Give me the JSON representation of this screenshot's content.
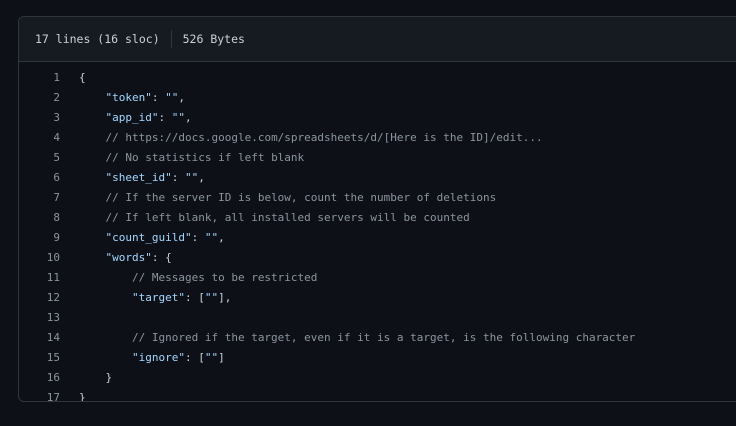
{
  "header": {
    "lines_info": "17 lines (16 sloc)",
    "size_info": "526 Bytes"
  },
  "colors": {
    "background": "#0d1117",
    "header_bg": "#161b22",
    "border": "#30363d",
    "text": "#c9d1d9",
    "key": "#a5d6ff",
    "comment": "#8b949e"
  },
  "code": {
    "lines": [
      {
        "num": "1",
        "indent": "",
        "parts": [
          {
            "t": "{",
            "k": "punct"
          }
        ]
      },
      {
        "num": "2",
        "indent": "    ",
        "parts": [
          {
            "t": "\"token\"",
            "k": "key"
          },
          {
            "t": ": ",
            "k": "punct"
          },
          {
            "t": "\"\"",
            "k": "str"
          },
          {
            "t": ",",
            "k": "punct"
          }
        ]
      },
      {
        "num": "3",
        "indent": "    ",
        "parts": [
          {
            "t": "\"app_id\"",
            "k": "key"
          },
          {
            "t": ": ",
            "k": "punct"
          },
          {
            "t": "\"\"",
            "k": "str"
          },
          {
            "t": ",",
            "k": "punct"
          }
        ]
      },
      {
        "num": "4",
        "indent": "    ",
        "parts": [
          {
            "t": "// https://docs.google.com/spreadsheets/d/[Here is the ID]/edit...",
            "k": "comment"
          }
        ]
      },
      {
        "num": "5",
        "indent": "    ",
        "parts": [
          {
            "t": "// No statistics if left blank",
            "k": "comment"
          }
        ]
      },
      {
        "num": "6",
        "indent": "    ",
        "parts": [
          {
            "t": "\"sheet_id\"",
            "k": "key"
          },
          {
            "t": ": ",
            "k": "punct"
          },
          {
            "t": "\"\"",
            "k": "str"
          },
          {
            "t": ",",
            "k": "punct"
          }
        ]
      },
      {
        "num": "7",
        "indent": "    ",
        "parts": [
          {
            "t": "// If the server ID is below, count the number of deletions",
            "k": "comment"
          }
        ]
      },
      {
        "num": "8",
        "indent": "    ",
        "parts": [
          {
            "t": "// If left blank, all installed servers will be counted",
            "k": "comment"
          }
        ]
      },
      {
        "num": "9",
        "indent": "    ",
        "parts": [
          {
            "t": "\"count_guild\"",
            "k": "key"
          },
          {
            "t": ": ",
            "k": "punct"
          },
          {
            "t": "\"\"",
            "k": "str"
          },
          {
            "t": ",",
            "k": "punct"
          }
        ]
      },
      {
        "num": "10",
        "indent": "    ",
        "parts": [
          {
            "t": "\"words\"",
            "k": "key"
          },
          {
            "t": ": {",
            "k": "punct"
          }
        ]
      },
      {
        "num": "11",
        "indent": "        ",
        "parts": [
          {
            "t": "// Messages to be restricted",
            "k": "comment"
          }
        ]
      },
      {
        "num": "12",
        "indent": "        ",
        "parts": [
          {
            "t": "\"target\"",
            "k": "key"
          },
          {
            "t": ": [",
            "k": "punct"
          },
          {
            "t": "\"\"",
            "k": "str"
          },
          {
            "t": "],",
            "k": "punct"
          }
        ]
      },
      {
        "num": "13",
        "indent": "",
        "parts": []
      },
      {
        "num": "14",
        "indent": "        ",
        "parts": [
          {
            "t": "// Ignored if the target, even if it is a target, is the following character",
            "k": "comment"
          }
        ]
      },
      {
        "num": "15",
        "indent": "        ",
        "parts": [
          {
            "t": "\"ignore\"",
            "k": "key"
          },
          {
            "t": ": [",
            "k": "punct"
          },
          {
            "t": "\"\"",
            "k": "str"
          },
          {
            "t": "]",
            "k": "punct"
          }
        ]
      },
      {
        "num": "16",
        "indent": "    ",
        "parts": [
          {
            "t": "}",
            "k": "punct"
          }
        ]
      },
      {
        "num": "17",
        "indent": "",
        "parts": [
          {
            "t": "}",
            "k": "punct"
          }
        ]
      }
    ]
  }
}
